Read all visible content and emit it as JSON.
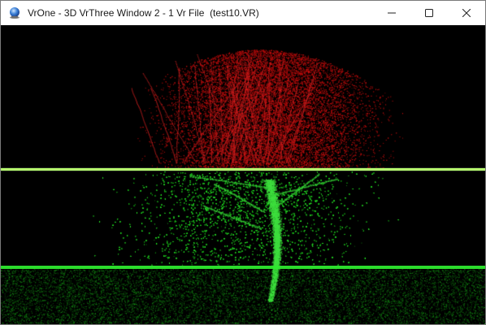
{
  "window": {
    "title": "VrOne - 3D VrThree Window 2 - 1 Vr File  (test10.VR)",
    "app_icon": "vrone-globe-icon",
    "buttons": [
      {
        "name": "minimize",
        "icon": "minimize-icon"
      },
      {
        "name": "maximize",
        "icon": "maximize-icon"
      },
      {
        "name": "close",
        "icon": "close-icon"
      }
    ]
  },
  "viewport": {
    "content": "3D point cloud of a tree",
    "background_color": "#000000",
    "colors": {
      "canopy_red": "#c01818",
      "lower_green": "#22c022",
      "upper_line": "#b6ff6e",
      "ground_line": "#2ee82e"
    }
  }
}
